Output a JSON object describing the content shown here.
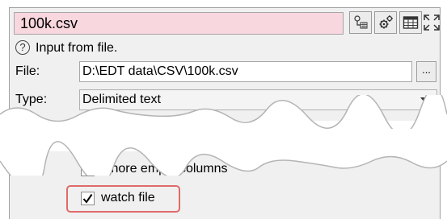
{
  "header": {
    "title_field_value": "100k.csv"
  },
  "toolbar": {
    "buttons": [
      {
        "icon": "schema-icon"
      },
      {
        "icon": "gears-icon"
      },
      {
        "icon": "table-icon"
      },
      {
        "icon": "maximize-icon"
      }
    ]
  },
  "help": {
    "text": "Input from file."
  },
  "file": {
    "label": "File:",
    "value": "D:\\EDT data\\CSV\\100k.csv",
    "browse_label": "..."
  },
  "type": {
    "label": "Type:",
    "value": "Delimited text"
  },
  "options": {
    "ignore_empty_columns": {
      "label": "ignore empty columns",
      "checked": false
    },
    "watch_file": {
      "label": "watch file",
      "checked": true
    }
  },
  "colors": {
    "title_bg": "#f8d7df",
    "highlight": "#e06a6a"
  }
}
